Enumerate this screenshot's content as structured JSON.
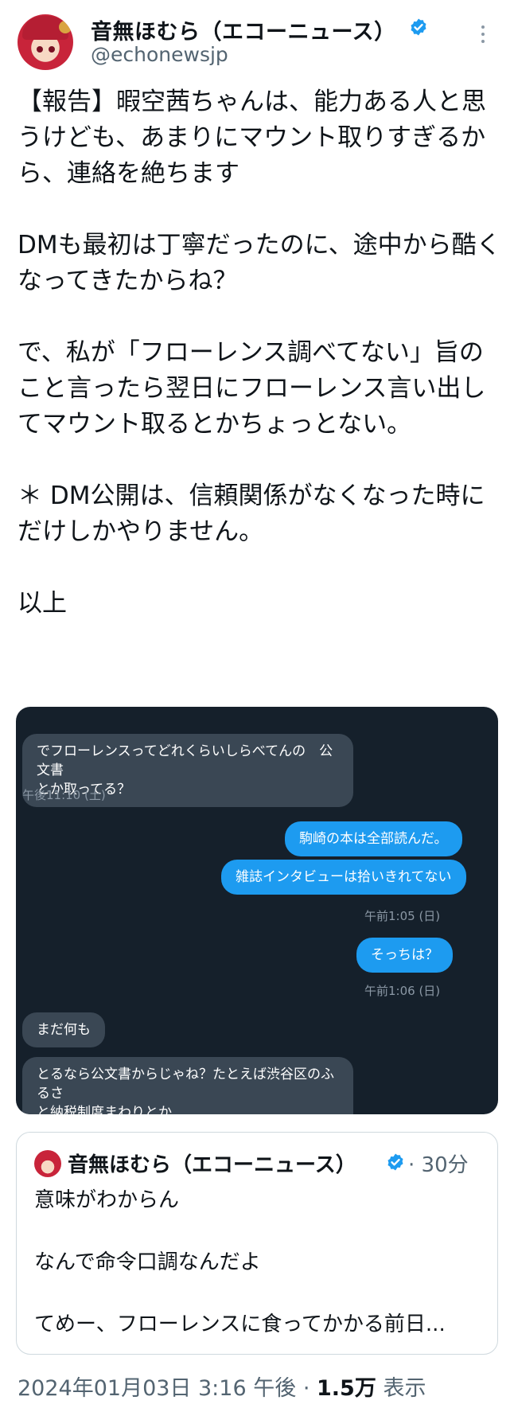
{
  "author": {
    "display_name": "音無ほむら（エコーニュース）",
    "handle": "@echonewsjp"
  },
  "tweet": {
    "text": "【報告】暇空茜ちゃんは、能力ある人と思うけども、あまりにマウント取りすぎるから、連絡を絶ちます\n\nDMも最初は丁寧だったのに、途中から酷くなってきたからね？\n\nで、私が「フローレンス調べてない」旨のこと言ったら翌日にフローレンス言い出してマウント取るとかちょっとない。\n\n＊ DM公開は、信頼関係がなくなった時にだけしかやりません。\n\n以上"
  },
  "dm_screenshot": {
    "messages": [
      {
        "side": "received",
        "text": "でフローレンスってどれくらいしらべてんの　公文書\nとか取ってる？"
      },
      {
        "side": "sent",
        "text": "駒崎の本は全部読んだ。"
      },
      {
        "side": "sent",
        "text": "雑誌インタビューは拾いきれてない"
      },
      {
        "side": "sent",
        "text": "そっちは？"
      },
      {
        "side": "received",
        "text": "まだ何も"
      },
      {
        "side": "received",
        "text": "とるなら公文書からじゃね？たとえば渋谷区のふるさ\nと納税制度まわりとか"
      }
    ],
    "timestamps": {
      "t1": "午後11:10 (土)",
      "t2": "午前1:05 (日)",
      "t3": "午前1:06 (日)"
    }
  },
  "quote": {
    "display_name": "音無ほむら（エコーニュース）",
    "time": "· 30分",
    "text": "意味がわからん\n\nなんで命令口調なんだよ\n\nてめー、フローレンスに食ってかかる前日..."
  },
  "meta": {
    "date": "2024年01月03日 3:16 午後",
    "separator": "·",
    "views_count": "1.5万",
    "views_label": "表示"
  },
  "colors": {
    "verified": "#1d9bf0",
    "dm_background": "#15202b",
    "dm_sent": "#1d9bf0",
    "dm_received": "#3a4754"
  }
}
